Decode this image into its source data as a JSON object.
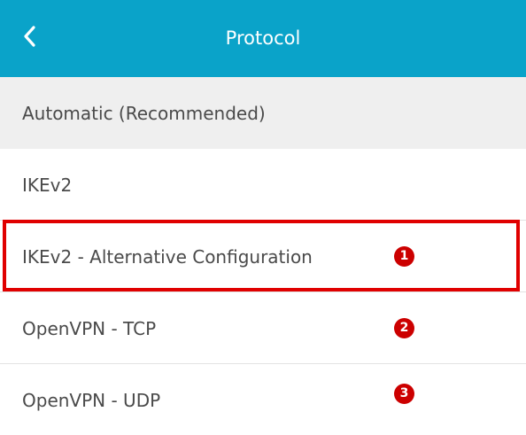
{
  "header": {
    "title": "Protocol"
  },
  "protocols": [
    {
      "label": "Automatic (Recommended)",
      "selected": true
    },
    {
      "label": "IKEv2",
      "selected": false
    },
    {
      "label": "IKEv2 - Alternative Configuration",
      "selected": false,
      "marker": "1"
    },
    {
      "label": "OpenVPN - TCP",
      "selected": false,
      "marker": "2"
    },
    {
      "label": "OpenVPN - UDP",
      "selected": false,
      "marker": "3"
    }
  ],
  "colors": {
    "header_background": "#0aa3c9",
    "selected_row_background": "#efefef",
    "annotation_red": "#e00000"
  },
  "icons": {
    "back": "chevron-left-icon"
  }
}
